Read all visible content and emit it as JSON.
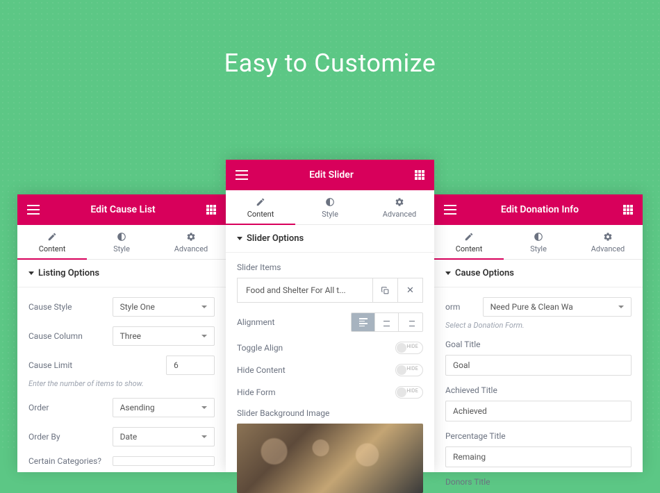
{
  "hero": {
    "title": "Easy to Customize"
  },
  "tabs": {
    "content": "Content",
    "style": "Style",
    "advanced": "Advanced"
  },
  "toggle": {
    "hide_label": "HIDE"
  },
  "panel_left": {
    "title": "Edit Cause List",
    "section": "Listing Options",
    "cause_style_label": "Cause Style",
    "cause_style_value": "Style One",
    "cause_column_label": "Cause Column",
    "cause_column_value": "Three",
    "cause_limit_label": "Cause Limit",
    "cause_limit_value": "6",
    "cause_limit_hint": "Enter the number of items to show.",
    "order_label": "Order",
    "order_value": "Asending",
    "order_by_label": "Order By",
    "order_by_value": "Date",
    "certain_categories_label": "Certain Categories?"
  },
  "panel_center": {
    "title": "Edit Slider",
    "section": "Slider Options",
    "slider_items_label": "Slider Items",
    "slider_item_title": "Food and Shelter For All t...",
    "alignment_label": "Alignment",
    "toggle_align_label": "Toggle Align",
    "hide_content_label": "Hide Content",
    "hide_form_label": "Hide Form",
    "bg_image_label": "Slider Background Image"
  },
  "panel_right": {
    "title": "Edit Donation Info",
    "section": "Cause Options",
    "form_label": "orm",
    "form_value": "Need Pure & Clean Wa",
    "form_hint": "Select a Donation Form.",
    "goal_title_label": "Goal Title",
    "goal_title_value": "Goal",
    "achieved_title_label": "Achieved Title",
    "achieved_title_value": "Achieved",
    "percentage_title_label": "Percentage Title",
    "percentage_title_value": "Remaing",
    "donors_title_label": "Donors Title"
  }
}
